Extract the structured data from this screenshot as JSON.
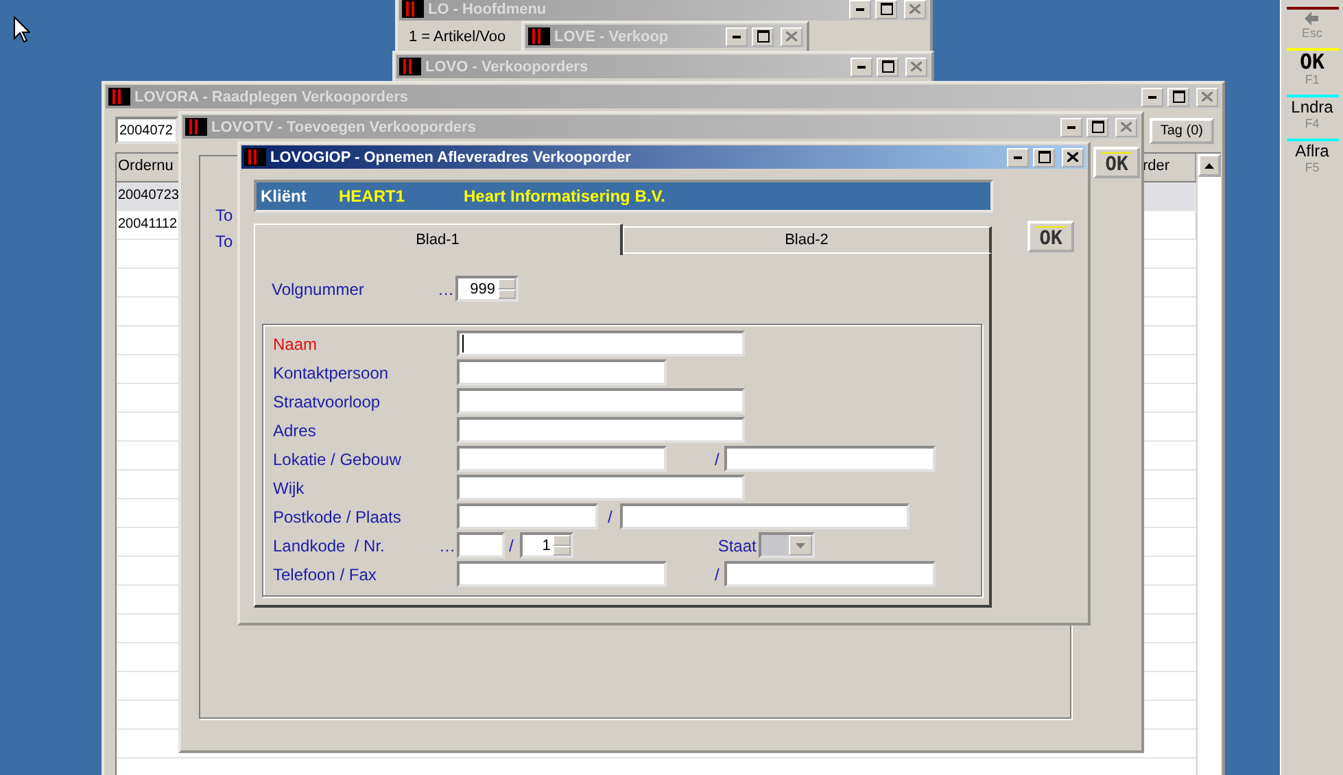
{
  "windows": [
    {
      "kind": "menu",
      "title": "LO - Hoofdmenu",
      "active": false,
      "lines": [
        "1 = Artikel/Voo"
      ]
    },
    {
      "kind": "plain",
      "title": "LOVE - Verkoop",
      "active": false
    },
    {
      "kind": "plain",
      "title": "LOVO - Verkooporders",
      "active": false
    },
    {
      "kind": "list",
      "title": "LOVORA - Raadplegen Verkooporders",
      "active": false,
      "search_value": "2004072",
      "tag_button": "Tag (0)",
      "columns": [
        "Ordernu",
        "rder"
      ],
      "rows": [
        {
          "cells": [
            "20040723"
          ],
          "selected": true
        },
        {
          "cells": [
            "20041112"
          ],
          "selected": false
        }
      ]
    },
    {
      "kind": "entry",
      "title": "LOVOTV - Toevoegen Verkooporders",
      "active": false,
      "labels": [
        "To",
        "To"
      ],
      "ok_button": "OK"
    },
    {
      "kind": "dialog",
      "title": "LOVOGIOP - Opnemen Afleveradres Verkooporder",
      "active": true,
      "client": {
        "label": "Kliënt",
        "code": "HEART1",
        "name": "Heart Informatisering B.V."
      },
      "tabs": [
        {
          "label": "Blad-1",
          "selected": true
        },
        {
          "label": "Blad-2",
          "selected": false
        }
      ],
      "sequence": {
        "label": "Volgnummer",
        "lookup": "…",
        "value": "999"
      },
      "fields": [
        {
          "kind": "wide",
          "label": "Naam",
          "required": true,
          "focused": true
        },
        {
          "kind": "medium",
          "label": "Kontaktpersoon",
          "required": false,
          "focused": false
        },
        {
          "kind": "wide",
          "label": "Straatvoorloop",
          "required": false,
          "focused": false
        },
        {
          "kind": "wide",
          "label": "Adres",
          "required": false,
          "focused": false
        },
        {
          "kind": "pair",
          "label": "Lokatie / Gebouw",
          "required": false,
          "focused": false,
          "separator": "/"
        },
        {
          "kind": "wide",
          "label": "Wijk",
          "required": false,
          "focused": false
        },
        {
          "kind": "postal",
          "label": "Postkode / Plaats",
          "required": false,
          "focused": false,
          "separator": "/"
        },
        {
          "kind": "country",
          "label": "Landkode  / Nr.",
          "required": false,
          "focused": false,
          "lookup": "…",
          "separator": "/",
          "number": "1",
          "extra_label": "Staat",
          "extra_disabled": true
        },
        {
          "kind": "pair",
          "label": "Telefoon / Fax",
          "required": false,
          "focused": false,
          "separator": "/"
        }
      ],
      "ok_button": "OK"
    }
  ],
  "toolbar": [
    {
      "kind": "icon",
      "key": "Esc",
      "color": "#800000",
      "disabled": true
    },
    {
      "kind": "text",
      "label": "OK",
      "key": "F1",
      "color": "#ffff00",
      "disabled": false
    },
    {
      "kind": "text",
      "label": "Lndra",
      "key": "F4",
      "color": "#00ffff",
      "disabled": false
    },
    {
      "kind": "text",
      "label": "Aflra",
      "key": "F5",
      "color": "#00ffff",
      "disabled": false
    }
  ]
}
